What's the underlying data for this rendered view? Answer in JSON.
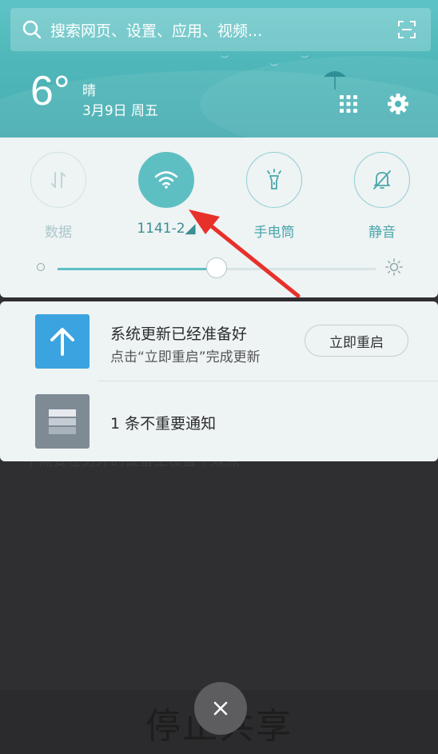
{
  "search": {
    "placeholder": "搜索网页、设置、应用、视频..."
  },
  "weather": {
    "temperature": "6°",
    "condition": "晴",
    "date": "3月9日 周五"
  },
  "quick_toggles": [
    {
      "label": "数据",
      "icon": "mobile-data-icon",
      "state": "disabled"
    },
    {
      "label": "1141-2◢",
      "icon": "wifi-icon",
      "state": "active"
    },
    {
      "label": "手电筒",
      "icon": "flashlight-icon",
      "state": "off"
    },
    {
      "label": "静音",
      "icon": "mute-bell-icon",
      "state": "off"
    }
  ],
  "brightness": {
    "level": 0.5
  },
  "notifications": [
    {
      "title": "系统更新已经准备好",
      "subtitle": "点击“立即重启”完成更新",
      "action": "立即重启",
      "icon": "upload-arrow-icon",
      "icon_color": "#3ba3e0"
    },
    {
      "title": "1 条不重要通知",
      "icon": "stacked-notifications-icon",
      "icon_color": "#7e8a94"
    }
  ],
  "background": {
    "partial_text": "不需要在另外的设备上设置个观点",
    "stop_share_label": "停止共享",
    "close_label": "×"
  },
  "colors": {
    "accent": "#5ebfc3",
    "header": "#4fb7b9",
    "annotation_arrow": "#e8302b"
  }
}
